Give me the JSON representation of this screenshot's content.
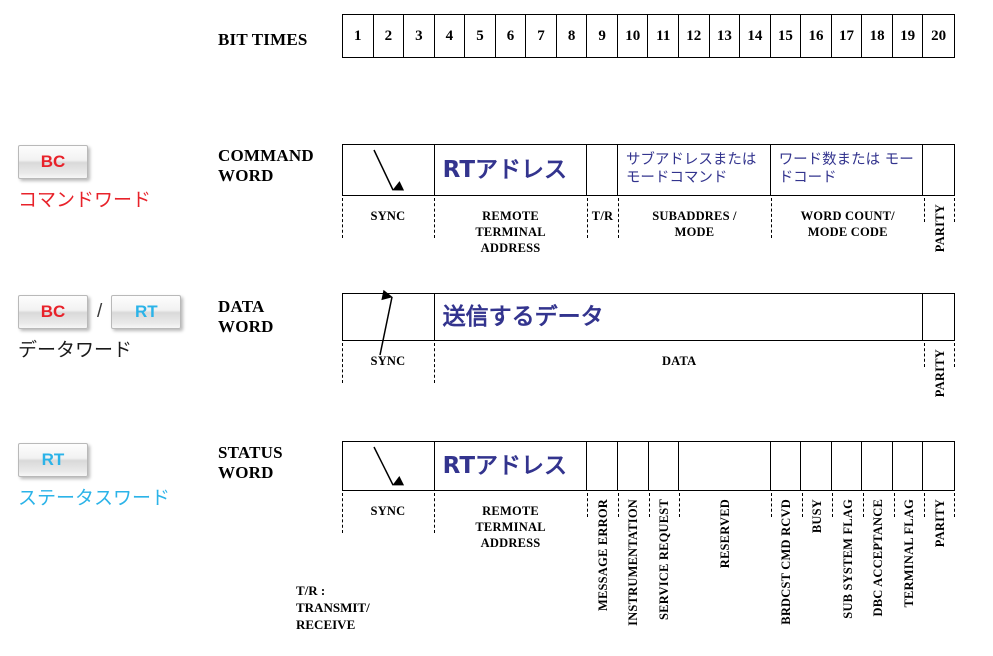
{
  "bit_times": {
    "label": "BIT TIMES",
    "numbers": [
      "1",
      "2",
      "3",
      "4",
      "5",
      "6",
      "7",
      "8",
      "9",
      "10",
      "11",
      "12",
      "13",
      "14",
      "15",
      "16",
      "17",
      "18",
      "19",
      "20"
    ]
  },
  "colors": {
    "bc_red": "#e8222a",
    "rt_cyan": "#2bb3e8",
    "field_blue": "#33348e",
    "line_black": "#000000",
    "background": "#ffffff"
  },
  "rows": [
    {
      "id": "command-word",
      "title": "COMMAND\nWORD",
      "badges": [
        {
          "text": "BC",
          "style": "bc"
        }
      ],
      "badge_caption": "コマンドワード",
      "badge_caption_color": "red",
      "arrow_direction": "down",
      "fields": [
        {
          "name": "sync",
          "jp": "",
          "bits": 3
        },
        {
          "name": "rt-address",
          "jp": "RTアドレス",
          "bits": 5
        },
        {
          "name": "tr",
          "jp": "",
          "bits": 1
        },
        {
          "name": "subaddress",
          "jp": "サブアドレスまたは\nモードコマンド",
          "bits": 5
        },
        {
          "name": "word-count",
          "jp": "ワード数または\nモードコード",
          "bits": 5
        },
        {
          "name": "parity",
          "jp": "",
          "bits": 1
        }
      ],
      "annotations": [
        {
          "text": "SYNC",
          "orient": "horizontal"
        },
        {
          "text": "REMOTE\nTERMINAL\nADDRESS",
          "orient": "horizontal"
        },
        {
          "text": "T/R",
          "orient": "horizontal"
        },
        {
          "text": "SUBADDRES /\nMODE",
          "orient": "horizontal"
        },
        {
          "text": "WORD COUNT/\nMODE CODE",
          "orient": "horizontal"
        },
        {
          "text": "PARITY",
          "orient": "vertical"
        }
      ]
    },
    {
      "id": "data-word",
      "title": "DATA\nWORD",
      "badges": [
        {
          "text": "BC",
          "style": "bc"
        },
        {
          "text": "RT",
          "style": "rt"
        }
      ],
      "badge_separator": "/",
      "badge_caption": "データワード",
      "badge_caption_color": "black",
      "arrow_direction": "up",
      "fields": [
        {
          "name": "sync",
          "jp": "",
          "bits": 3
        },
        {
          "name": "data",
          "jp": "送信するデータ",
          "bits": 16
        },
        {
          "name": "parity",
          "jp": "",
          "bits": 1
        }
      ],
      "annotations": [
        {
          "text": "SYNC",
          "orient": "horizontal"
        },
        {
          "text": "DATA",
          "orient": "horizontal"
        },
        {
          "text": "PARITY",
          "orient": "vertical"
        }
      ]
    },
    {
      "id": "status-word",
      "title": "STATUS\nWORD",
      "badges": [
        {
          "text": "RT",
          "style": "rt"
        }
      ],
      "badge_caption": "ステータスワード",
      "badge_caption_color": "cyan",
      "arrow_direction": "down",
      "fields": [
        {
          "name": "sync",
          "jp": "",
          "bits": 3
        },
        {
          "name": "rt-address",
          "jp": "RTアドレス",
          "bits": 5
        },
        {
          "name": "message-error",
          "jp": "",
          "bits": 1
        },
        {
          "name": "instrumentation",
          "jp": "",
          "bits": 1
        },
        {
          "name": "service-request",
          "jp": "",
          "bits": 1
        },
        {
          "name": "reserved",
          "jp": "",
          "bits": 3
        },
        {
          "name": "brdcst-cmd-rcvd",
          "jp": "",
          "bits": 1
        },
        {
          "name": "busy",
          "jp": "",
          "bits": 1
        },
        {
          "name": "sub-system-flag",
          "jp": "",
          "bits": 1
        },
        {
          "name": "dbc-acceptance",
          "jp": "",
          "bits": 1
        },
        {
          "name": "terminal-flag",
          "jp": "",
          "bits": 1
        },
        {
          "name": "parity",
          "jp": "",
          "bits": 1
        }
      ],
      "annotations": [
        {
          "text": "SYNC",
          "orient": "horizontal"
        },
        {
          "text": "REMOTE\nTERMINAL\nADDRESS",
          "orient": "horizontal"
        },
        {
          "text": "MESSAGE ERROR",
          "orient": "vertical"
        },
        {
          "text": "INSTRUMENTATION",
          "orient": "vertical"
        },
        {
          "text": "SERVICE REQUEST",
          "orient": "vertical"
        },
        {
          "text": "RESERVED",
          "orient": "vertical"
        },
        {
          "text": "BRDCST CMD RCVD",
          "orient": "vertical"
        },
        {
          "text": "BUSY",
          "orient": "vertical"
        },
        {
          "text": "SUB SYSTEM FLAG",
          "orient": "vertical"
        },
        {
          "text": "DBC ACCEPTANCE",
          "orient": "vertical"
        },
        {
          "text": "TERMINAL FLAG",
          "orient": "vertical"
        },
        {
          "text": "PARITY",
          "orient": "vertical"
        }
      ]
    }
  ],
  "footnote": "T/R :\nTRANSMIT/\nRECEIVE"
}
